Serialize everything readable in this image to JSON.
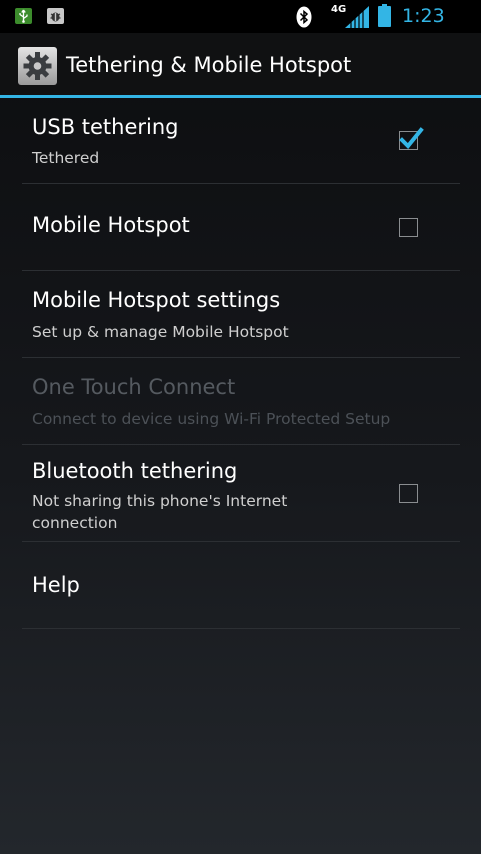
{
  "status_bar": {
    "network_label": "4G",
    "time": "1:23",
    "icons": [
      "usb-notification-icon",
      "usb-debugging-icon",
      "bluetooth-icon",
      "signal-icon",
      "battery-icon"
    ]
  },
  "action_bar": {
    "title": "Tethering & Mobile Hotspot",
    "icon": "settings-gear-icon"
  },
  "items": [
    {
      "title": "USB tethering",
      "summary": "Tethered",
      "checkbox": true,
      "checked": true,
      "enabled": true
    },
    {
      "title": "Mobile Hotspot",
      "summary": "",
      "checkbox": true,
      "checked": false,
      "enabled": true
    },
    {
      "title": "Mobile Hotspot settings",
      "summary": "Set up & manage Mobile Hotspot",
      "checkbox": false,
      "enabled": true
    },
    {
      "title": "One Touch Connect",
      "summary": "Connect to device using Wi-Fi Protected Setup",
      "checkbox": false,
      "enabled": false
    },
    {
      "title": "Bluetooth tethering",
      "summary": "Not sharing this phone's Internet connection",
      "checkbox": true,
      "checked": false,
      "enabled": true
    },
    {
      "title": "Help",
      "summary": "",
      "checkbox": false,
      "enabled": true
    }
  ],
  "colors": {
    "accent": "#33b5e5",
    "text_primary": "#ffffff",
    "text_secondary": "#cfcfcf",
    "text_disabled": "#555a60"
  }
}
